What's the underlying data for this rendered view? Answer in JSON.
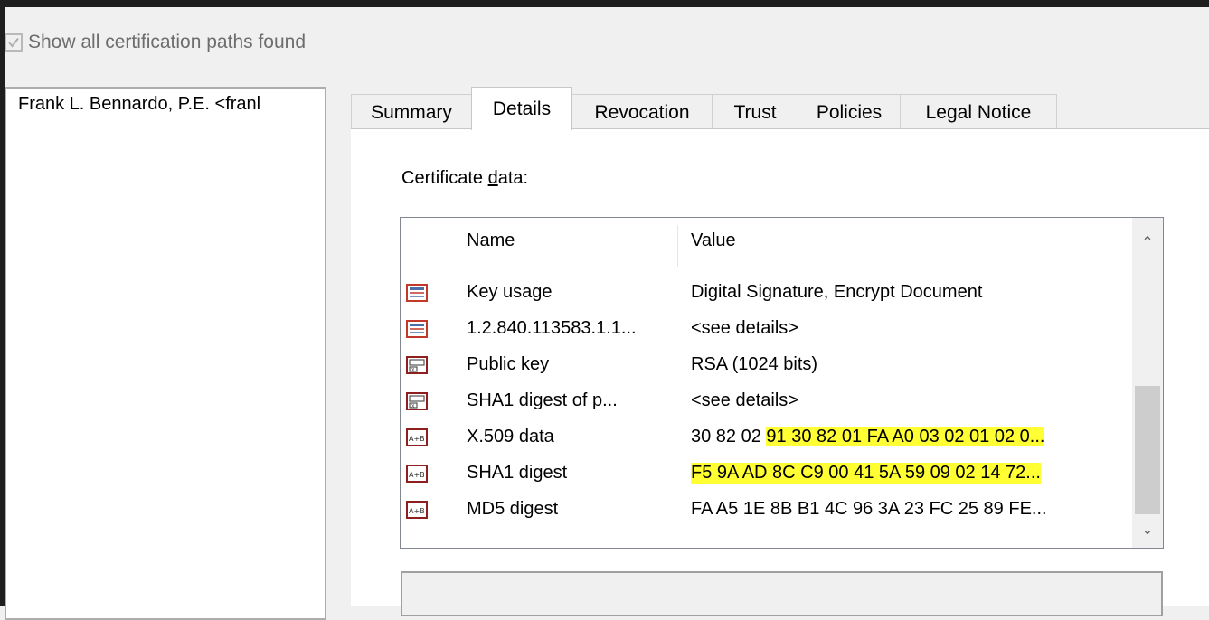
{
  "show_all": {
    "label": "Show all certification paths found",
    "checked": true
  },
  "path_list": {
    "items": [
      "Frank L. Bennardo, P.E. <franl"
    ]
  },
  "tabs": [
    "Summary",
    "Details",
    "Revocation",
    "Trust",
    "Policies",
    "Legal Notice"
  ],
  "selected_tab": "Details",
  "certificate_data": {
    "label_before": "Certificate ",
    "label_mnemonic": "d",
    "label_after": "ata:",
    "columns": {
      "name": "Name",
      "value": "Value"
    },
    "rows": [
      {
        "icon": "certificate-extension-icon",
        "name": "Key usage",
        "value": "Digital Signature, Encrypt Document"
      },
      {
        "icon": "certificate-extension-icon",
        "name": "1.2.840.113583.1.1...",
        "value": "<see details>"
      },
      {
        "icon": "certificate-key-icon",
        "name": "Public key",
        "value": "RSA (1024 bits)"
      },
      {
        "icon": "certificate-key-icon",
        "name": "SHA1 digest of p...",
        "value": "<see details>"
      },
      {
        "icon": "binary-data-icon",
        "name": "X.509 data",
        "value_plain": "30 82 02 ",
        "value_highlight": "91 30 82 01 FA A0 03 02 01 02 0...",
        "value": "30 82 02 91 30 82 01 FA A0 03 02 01 02 0..."
      },
      {
        "icon": "binary-data-icon",
        "name": "SHA1 digest",
        "value": "F5 9A AD 8C C9 00 41 5A 59 09 02 14 72...",
        "highlighted": true
      },
      {
        "icon": "binary-data-icon",
        "name": "MD5 digest",
        "value": "FA A5 1E 8B B1 4C 96 3A 23 FC 25 89 FE..."
      }
    ]
  },
  "colors": {
    "highlight": "#ffff33",
    "accent_icon": "#c0392b"
  }
}
